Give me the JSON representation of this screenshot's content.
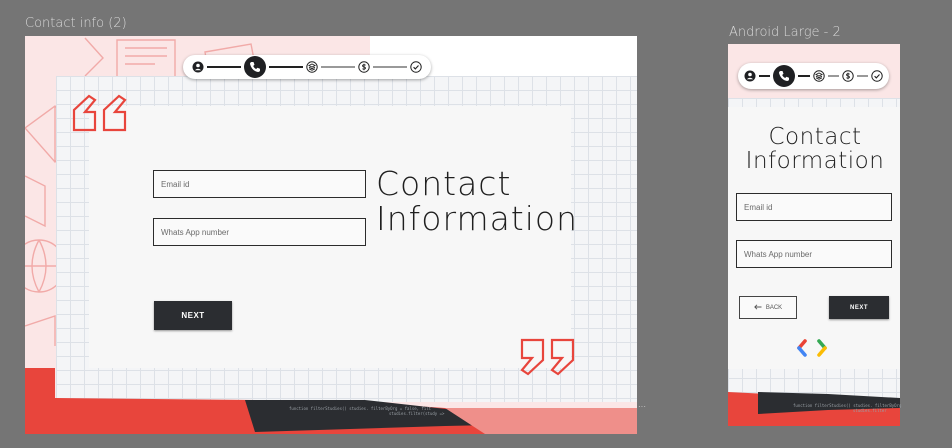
{
  "frames": {
    "desktop": {
      "title": "Contact info (2)",
      "heading_line1": "Contact",
      "heading_line2": "Information",
      "email_placeholder": "Email id",
      "whatsapp_placeholder": "Whats App number",
      "next_label": "NEXT",
      "code_line1": "function filterStudies() studies. filterByOrg = false, filt",
      "code_line2": "studies.filter(study =>"
    },
    "mobile": {
      "title": "Android Large - 2",
      "heading_line1": "Contact",
      "heading_line2": "Information",
      "email_placeholder": "Email id",
      "whatsapp_placeholder": "Whats App number",
      "back_label": "BACK",
      "next_label": "NEXT",
      "code_line1": "function filterStudies() studies. filterByOrg",
      "code_line2": "studies.filter"
    }
  },
  "stepper": {
    "steps": [
      "person-icon",
      "phone-icon",
      "layers-icon",
      "coin-icon",
      "check-circle-icon"
    ],
    "active_index": 1,
    "completed_count": 2
  },
  "overflow_dots": "···",
  "colors": {
    "canvas": "#757575",
    "accent_red": "#e8453c",
    "pink_bg": "#fbe6e6",
    "dark_button": "#2b2d31",
    "logo_red": "#ea4335",
    "logo_yellow": "#fbbc04",
    "logo_blue": "#4285f4",
    "logo_green": "#34a853"
  }
}
